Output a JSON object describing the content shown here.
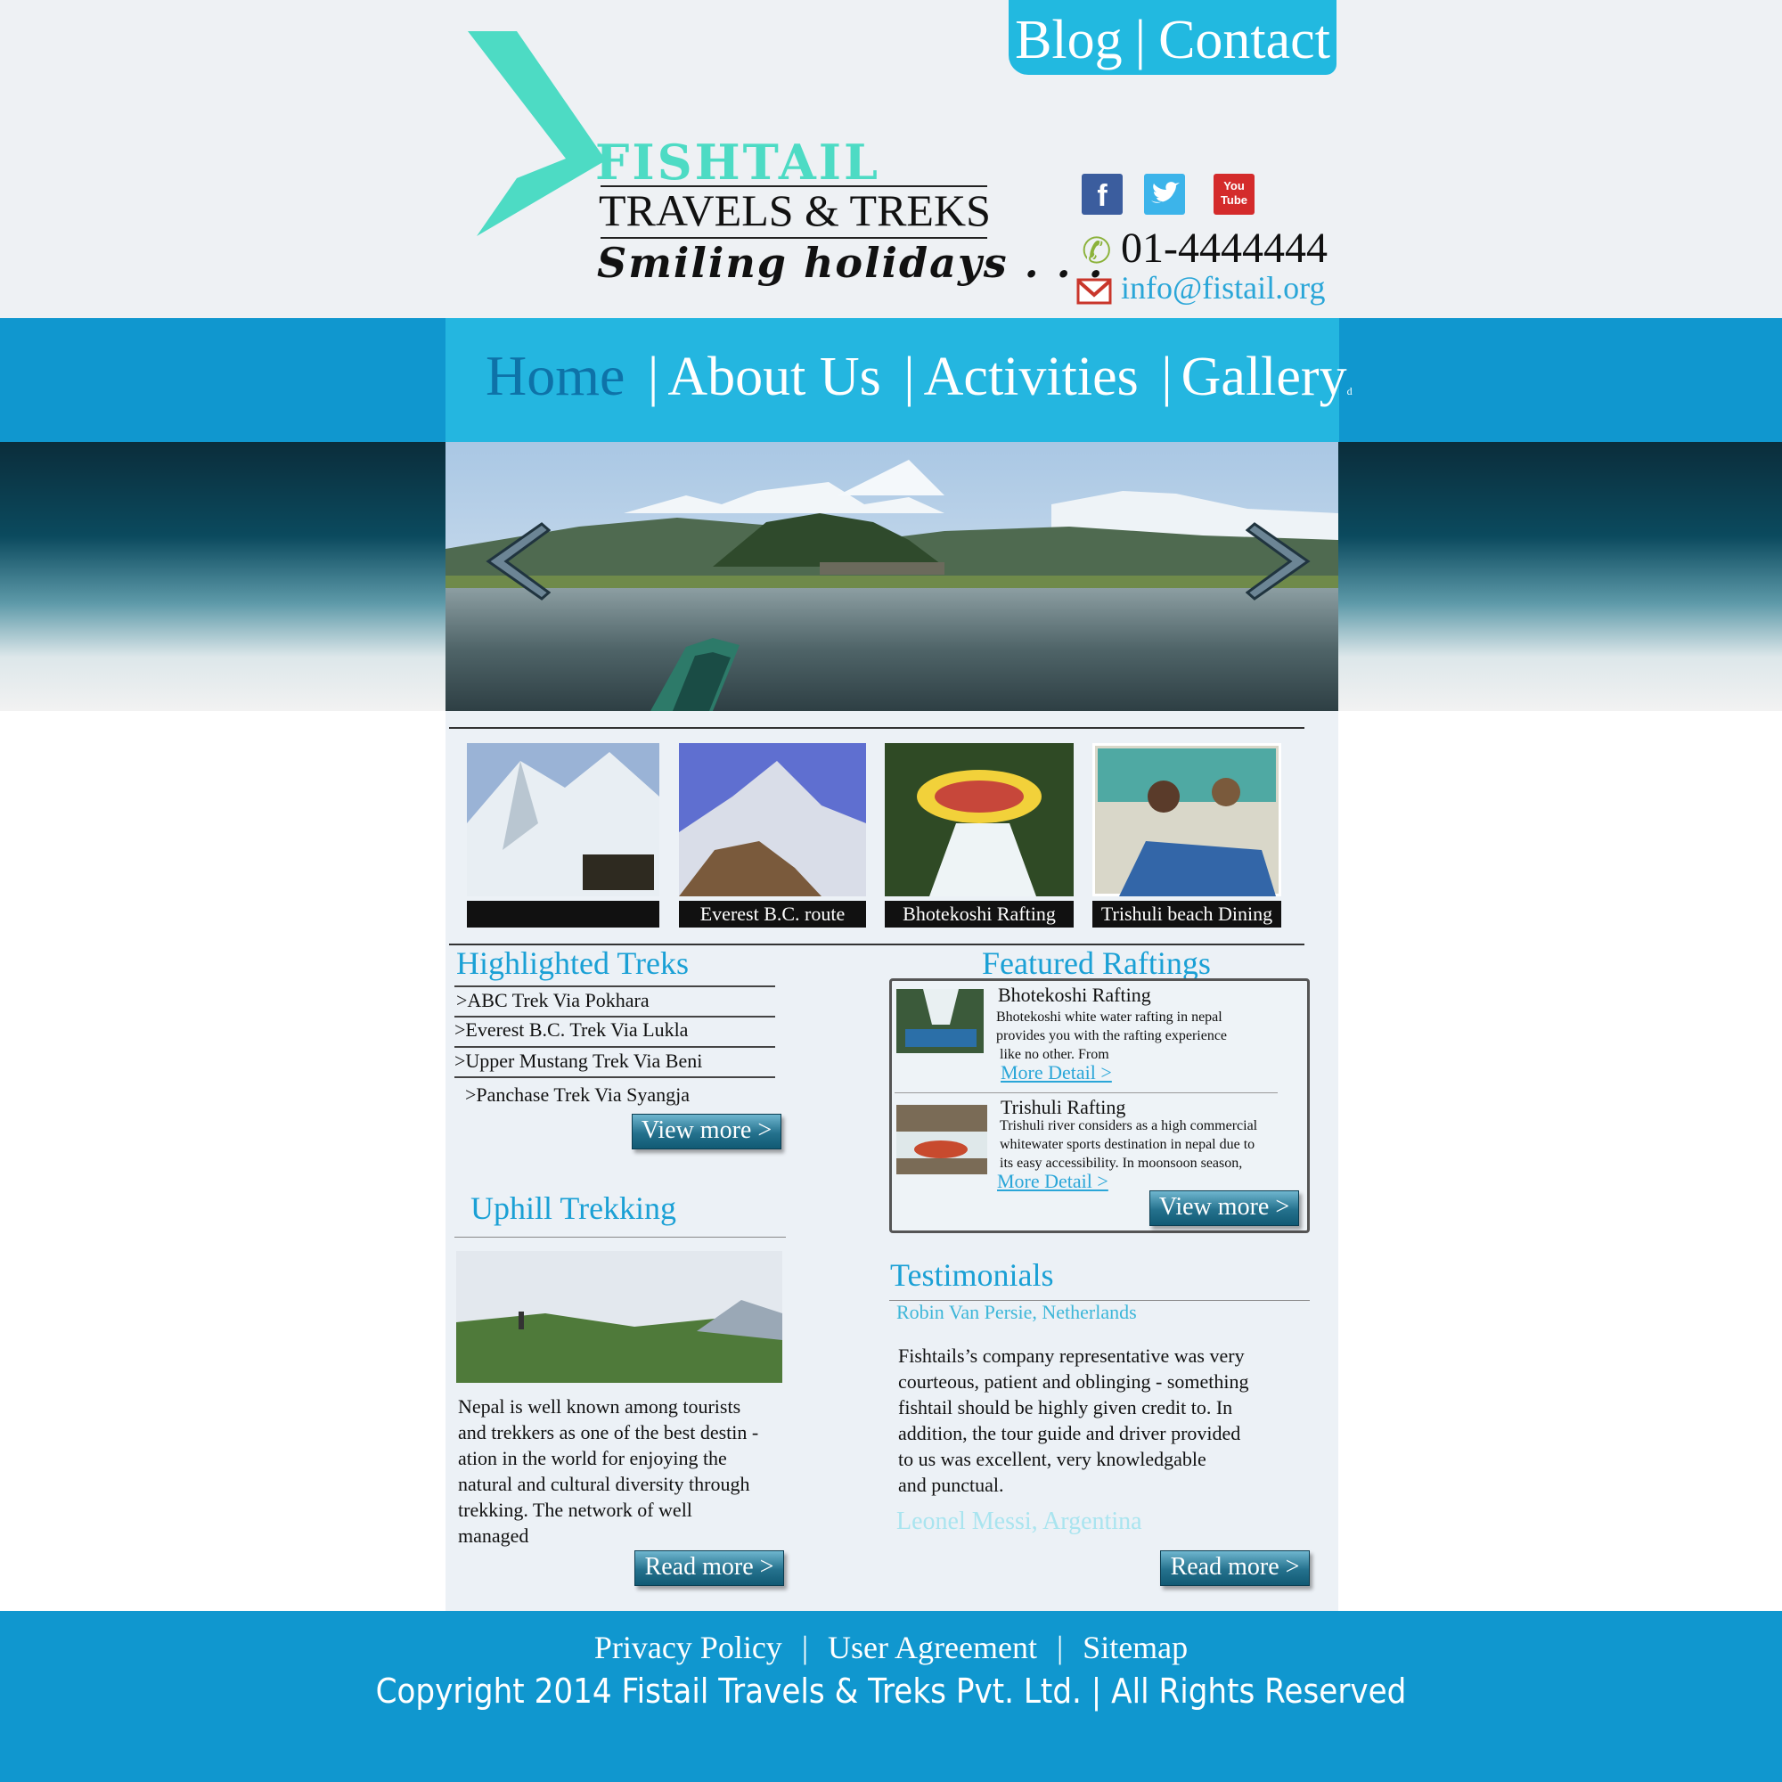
{
  "topbar": {
    "blog": "Blog",
    "separator": "|",
    "contact": "Contact"
  },
  "logo": {
    "fishtail": "FISHTAIL",
    "travels": "TRAVELS & TREKS",
    "tagline": "Smiling holidays . . .",
    "accent_color": "#4ddbc4"
  },
  "social": {
    "facebook": "f",
    "twitter": "t",
    "youtube_top": "You",
    "youtube_bottom": "Tube"
  },
  "contact": {
    "phone": "01-4444444",
    "email": "info@fistail.org"
  },
  "nav": {
    "home": "Home",
    "about": "About Us",
    "activities": "Activities",
    "gallery": "Gallery",
    "stray_mark": "d",
    "separator": "|"
  },
  "thumbnails": [
    {
      "caption": ""
    },
    {
      "caption": "Everest B.C. route"
    },
    {
      "caption": "Bhotekoshi Rafting"
    },
    {
      "caption": "Trishuli beach Dining"
    }
  ],
  "highlighted_treks": {
    "title": "Highlighted Treks",
    "items": [
      ">ABC Trek Via Pokhara",
      ">Everest B.C. Trek Via Lukla",
      ">Upper Mustang Trek Via Beni",
      ">Panchase Trek Via Syangja"
    ],
    "button": "View more >"
  },
  "featured_raftings": {
    "title": "Featured Raftings",
    "items": [
      {
        "title": "Bhotekoshi Rafting",
        "line1": "Bhotekoshi white water rafting in nepal",
        "line2": "provides you with the rafting experience",
        "line3": " like no other. From",
        "link": "More Detail >"
      },
      {
        "title": "Trishuli Rafting",
        "line1": "Trishuli river considers as a high commercial",
        "line2": "whitewater sports destination in nepal due to",
        "line3": "its easy accessibility. In moonsoon season,",
        "link": "More Detail >"
      }
    ],
    "button": "View more >"
  },
  "uphill": {
    "title": "Uphill Trekking",
    "lines": [
      "Nepal is well known among tourists",
      "and trekkers as one of the best destin -",
      "ation in the world for enjoying the",
      "natural and cultural diversity through",
      "trekking. The network of well",
      "managed"
    ],
    "button": "Read more >"
  },
  "testimonials": {
    "title": "Testimonials",
    "name1": "Robin Van Persie, Netherlands",
    "lines": [
      "Fishtails’s company representative was very",
      "courteous, patient and oblinging - something",
      "fishtail should be highly given credit to. In",
      "addition, the tour guide and driver provided",
      "to us was excellent, very knowledgable",
      "and punctual."
    ],
    "name2": "Leonel Messi, Argentina",
    "button": "Read more >"
  },
  "footer": {
    "privacy": "Privacy Policy",
    "agreement": "User Agreement",
    "sitemap": "Sitemap",
    "separator": "|",
    "copyright": "Copyright 2014 Fistail Travels & Treks Pvt. Ltd.  |  All Rights Reserved"
  },
  "colors": {
    "nav_band": "#1097cf",
    "nav_center": "#24b6e0",
    "topbar": "#22b9e0",
    "link": "#1aa0d5",
    "footer": "#1097cf"
  }
}
